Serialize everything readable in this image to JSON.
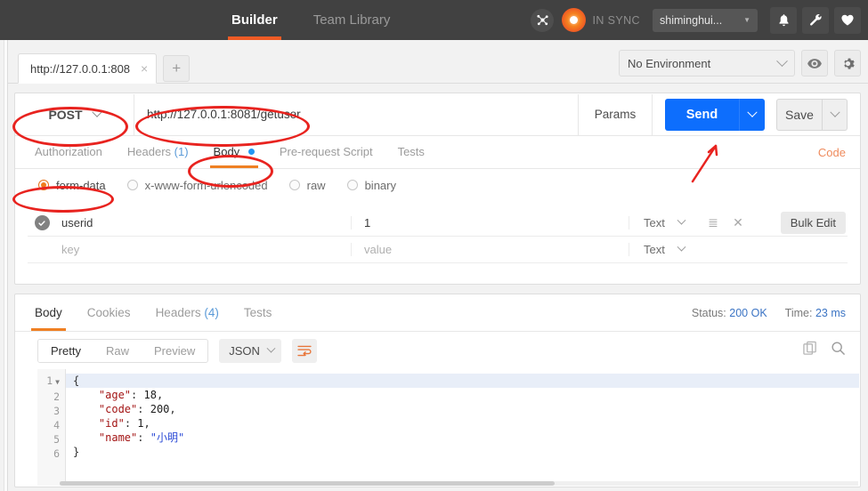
{
  "header": {
    "tabs": [
      {
        "label": "Builder",
        "active": true
      },
      {
        "label": "Team Library",
        "active": false
      }
    ],
    "sync_label": "IN SYNC",
    "user": "shiminghui...",
    "icons": [
      "network-icon",
      "sync-orb-icon",
      "bell-icon",
      "wrench-icon",
      "heart-icon"
    ],
    "accent": "#ef5b25",
    "background": "#414141"
  },
  "tabstrip": {
    "request_tab": "http://127.0.0.1:808",
    "close_label": "×",
    "add_label": "+",
    "environment": "No Environment",
    "eye_icon": "eye-icon",
    "gear_icon": "gear-icon"
  },
  "request": {
    "method": "POST",
    "url": "http://127.0.0.1:8081/getuser",
    "params_label": "Params",
    "send_label": "Send",
    "save_label": "Save",
    "tabs": [
      {
        "label": "Authorization",
        "active": false,
        "count": "",
        "dot": false
      },
      {
        "label": "Headers",
        "active": false,
        "count": "(1)",
        "dot": false
      },
      {
        "label": "Body",
        "active": true,
        "count": "",
        "dot": true
      },
      {
        "label": "Pre-request Script",
        "active": false,
        "count": "",
        "dot": false
      },
      {
        "label": "Tests",
        "active": false,
        "count": "",
        "dot": false
      }
    ],
    "code_link": "Code",
    "body_types": [
      {
        "label": "form-data",
        "selected": true
      },
      {
        "label": "x-www-form-urlencoded",
        "selected": false
      },
      {
        "label": "raw",
        "selected": false
      },
      {
        "label": "binary",
        "selected": false
      }
    ],
    "table": {
      "rows": [
        {
          "checked": true,
          "key": "userid",
          "value": "1",
          "type": "Text",
          "is_placeholder": false
        },
        {
          "checked": false,
          "key": "key",
          "value": "value",
          "type": "Text",
          "is_placeholder": true
        }
      ],
      "bulk_edit_label": "Bulk Edit",
      "row_menu_icon": "list-icon",
      "row_delete_icon": "close-icon"
    }
  },
  "response": {
    "tabs": [
      {
        "label": "Body",
        "active": true,
        "count": ""
      },
      {
        "label": "Cookies",
        "active": false,
        "count": ""
      },
      {
        "label": "Headers",
        "active": false,
        "count": "(4)"
      },
      {
        "label": "Tests",
        "active": false,
        "count": ""
      }
    ],
    "status_label": "Status:",
    "status_value": "200 OK",
    "time_label": "Time:",
    "time_value": "23 ms",
    "view_modes": [
      {
        "label": "Pretty",
        "active": true
      },
      {
        "label": "Raw",
        "active": false
      },
      {
        "label": "Preview",
        "active": false
      }
    ],
    "format": "JSON",
    "wrap_icon": "word-wrap-icon",
    "copy_icon": "copy-icon",
    "search_icon": "search-icon",
    "body_lines": [
      {
        "num": "1",
        "fold": true,
        "text": "{"
      },
      {
        "num": "2",
        "fold": false,
        "text": "    \"age\": 18,"
      },
      {
        "num": "3",
        "fold": false,
        "text": "    \"code\": 200,"
      },
      {
        "num": "4",
        "fold": false,
        "text": "    \"id\": 1,"
      },
      {
        "num": "5",
        "fold": false,
        "text": "    \"name\": \"小明\""
      },
      {
        "num": "6",
        "fold": false,
        "text": "}"
      }
    ],
    "json": {
      "age": "18",
      "code": "200",
      "id": "1",
      "name": "小明"
    }
  },
  "annotations": {
    "color": "#e8231f",
    "ellipses": [
      "method-selector",
      "url-input",
      "body-tab",
      "form-data-radio"
    ],
    "arrow_target": "send-button"
  }
}
